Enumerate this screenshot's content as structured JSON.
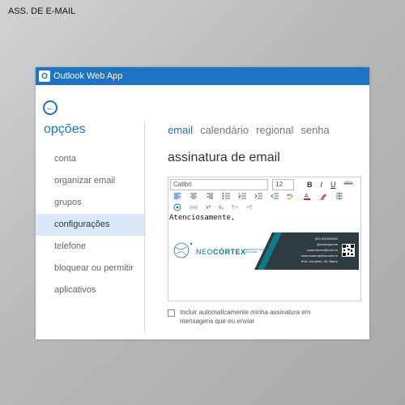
{
  "page_label": "ASS. DE E-MAIL",
  "window": {
    "title": "Outlook Web App",
    "logo_letter": "O"
  },
  "sidebar": {
    "title": "opções",
    "items": [
      {
        "label": "conta"
      },
      {
        "label": "organizar email"
      },
      {
        "label": "grupos"
      },
      {
        "label": "configurações",
        "active": true
      },
      {
        "label": "telefone"
      },
      {
        "label": "bloquear ou permitir"
      },
      {
        "label": "aplicativos"
      }
    ]
  },
  "tabs": [
    {
      "label": "email",
      "active": true
    },
    {
      "label": "calendário"
    },
    {
      "label": "regional"
    },
    {
      "label": "senha"
    }
  ],
  "section_title": "assinatura de email",
  "editor": {
    "font": "Calibri",
    "size": "12",
    "format_buttons": [
      "B",
      "I",
      "U",
      "abc"
    ],
    "row2_icons": [
      "align-left-icon",
      "align-center-icon",
      "align-right-icon",
      "bullet-list-icon",
      "numbered-list-icon",
      "indent-icon",
      "outdent-icon",
      "spellcheck-icon",
      "font-color-icon",
      "highlight-icon",
      "line-spacing-icon"
    ],
    "row3": {
      "superscript": "x²",
      "subscript": "x₂",
      "ltr": "¶≡",
      "rtl": "≡¶"
    },
    "signature_text": "Atenciosamente,",
    "banner": {
      "brand_plain": "NEO",
      "brand_bold": "CÓRTEX",
      "tagline": [
        "NEUROPSICOLOGIA",
        "AVANÇADA"
      ],
      "contact": [
        "(00) 000000000",
        "@suaempresa",
        "suaempresa@com.br",
        "www.suaempresa.com.br",
        "End. completo, 00, Bairro"
      ],
      "accent": "#0c7b8c",
      "dark": "#2e3b41"
    }
  },
  "checkbox": {
    "label_line1": "Incluir automaticamente minha assinatura em",
    "label_line2": "mensagens que eu enviar",
    "checked": false
  },
  "colors": {
    "brand_blue": "#1f73c5",
    "active_nav_bg": "#dbeaf8"
  }
}
